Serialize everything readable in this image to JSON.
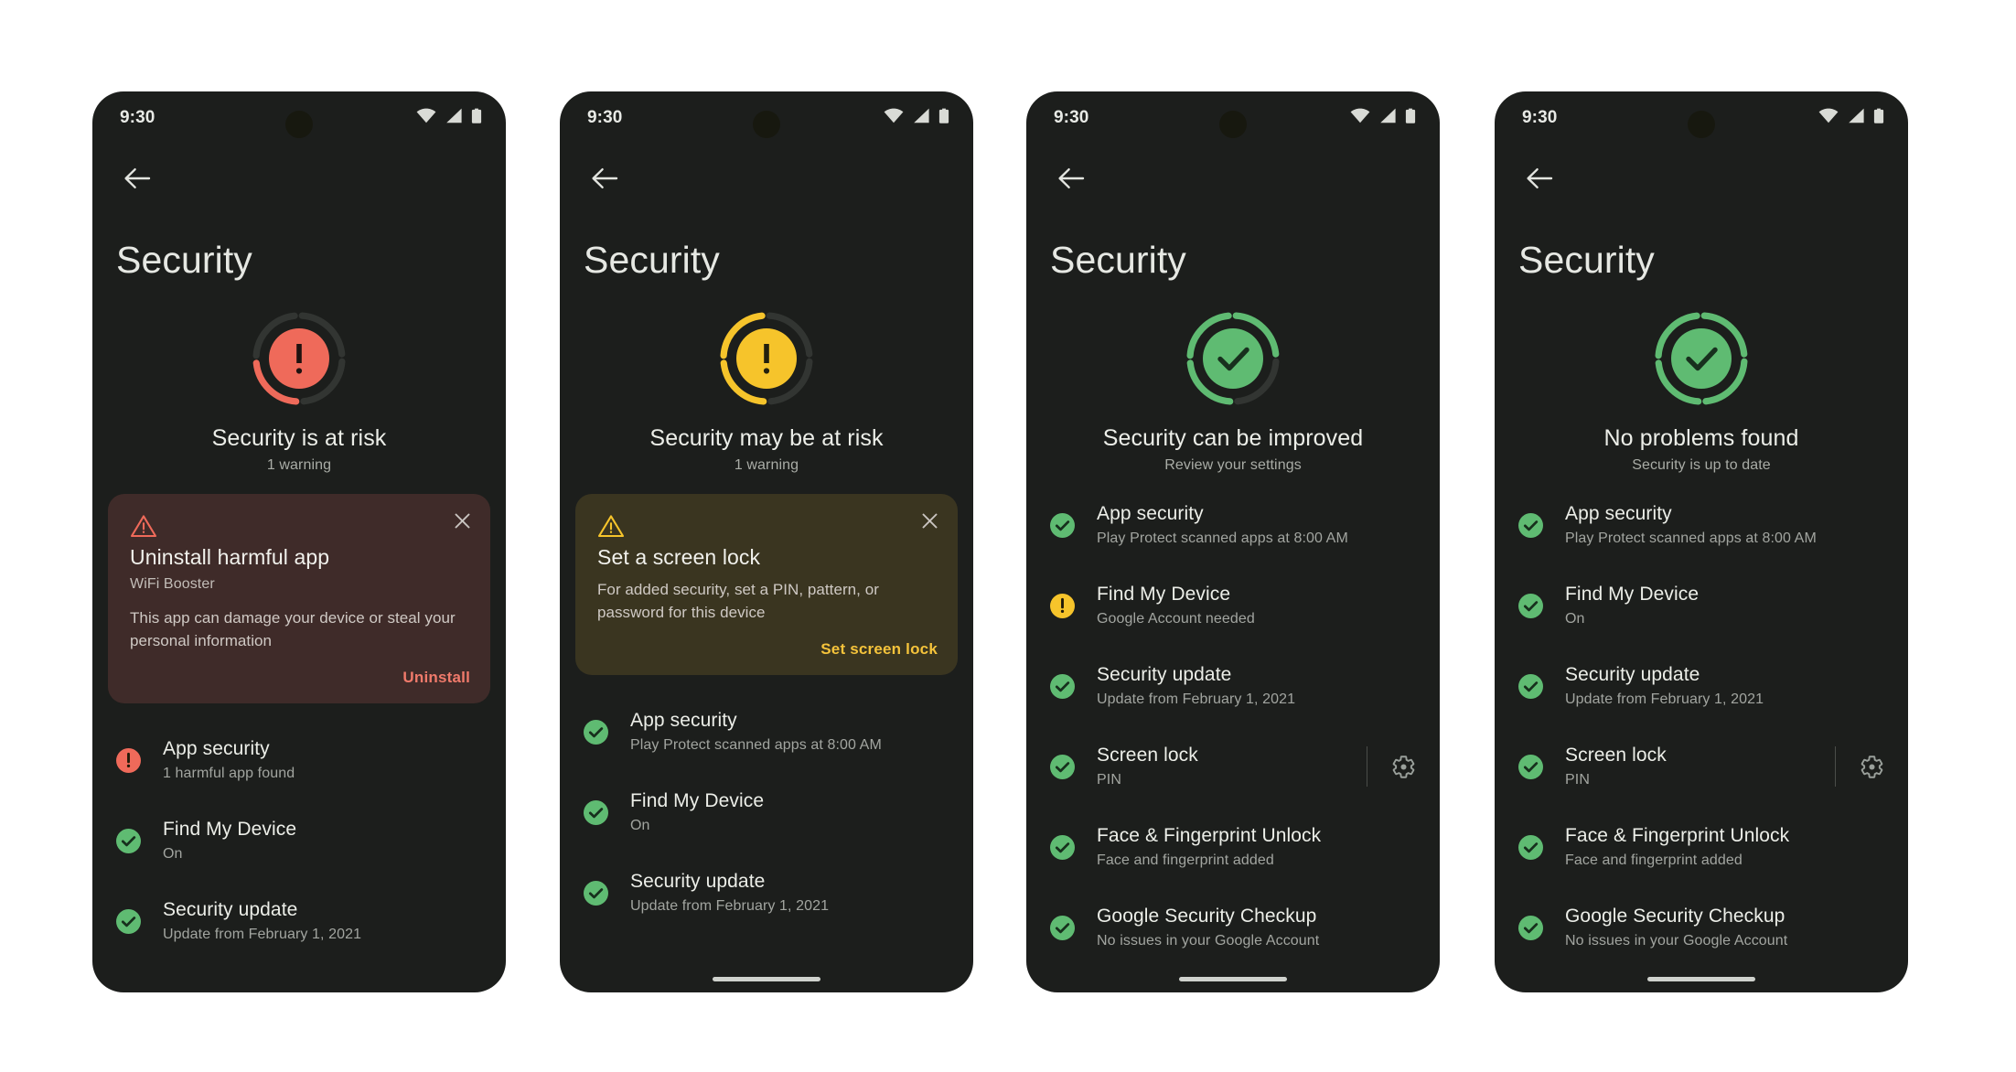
{
  "colors": {
    "page_background": "#ffffff",
    "phone_background": "#1c1e1c",
    "danger": "#ef6a5a",
    "warning": "#f6c42b",
    "success": "#5fbb72",
    "ring_track": "#323532",
    "card_danger_bg": "#3f2b29",
    "card_warn_bg": "#3a3520"
  },
  "statusbar": {
    "time": "9:30",
    "icons": [
      "wifi-icon",
      "cellular-signal-icon",
      "battery-icon"
    ]
  },
  "common": {
    "back_label": "Back",
    "page_title": "Security",
    "close_label": "Close"
  },
  "phones": [
    {
      "id": "phone-at-risk",
      "state": "danger",
      "hero": {
        "title": "Security is at risk",
        "subtitle": "1 warning",
        "icon": "exclamation-icon",
        "ring_segments": [
          "track",
          "track",
          "track",
          "danger"
        ]
      },
      "card": {
        "variant": "danger",
        "icon": "warning-triangle-icon",
        "title": "Uninstall harmful app",
        "app": "WiFi Booster",
        "body": "This app can damage your device or steal your personal information",
        "action": "Uninstall"
      },
      "rows": [
        {
          "status": "danger",
          "icon": "alert-badge-icon",
          "title": "App security",
          "sub": "1 harmful app found"
        },
        {
          "status": "success",
          "icon": "check-badge-icon",
          "title": "Find My Device",
          "sub": "On"
        },
        {
          "status": "success",
          "icon": "check-badge-icon",
          "title": "Security update",
          "sub": "Update from February 1, 2021"
        }
      ],
      "home_indicator": false
    },
    {
      "id": "phone-may-be-at-risk",
      "state": "warning",
      "hero": {
        "title": "Security may be at risk",
        "subtitle": "1 warning",
        "icon": "exclamation-icon",
        "ring_segments": [
          "warning",
          "track",
          "track",
          "warning"
        ]
      },
      "card": {
        "variant": "warning",
        "icon": "warning-triangle-icon",
        "title": "Set a screen lock",
        "app": "",
        "body": "For added security, set a PIN, pattern, or password for this device",
        "action": "Set screen lock"
      },
      "rows": [
        {
          "status": "success",
          "icon": "check-badge-icon",
          "title": "App security",
          "sub": "Play Protect scanned apps at 8:00 AM"
        },
        {
          "status": "success",
          "icon": "check-badge-icon",
          "title": "Find My Device",
          "sub": "On"
        },
        {
          "status": "success",
          "icon": "check-badge-icon",
          "title": "Security update",
          "sub": "Update from February 1, 2021"
        }
      ],
      "home_indicator": true
    },
    {
      "id": "phone-can-be-improved",
      "state": "success",
      "hero": {
        "title": "Security can be improved",
        "subtitle": "Review your settings",
        "icon": "check-icon",
        "ring_segments": [
          "success",
          "success",
          "track",
          "success"
        ]
      },
      "card": null,
      "rows": [
        {
          "status": "success",
          "icon": "check-badge-icon",
          "title": "App security",
          "sub": "Play Protect scanned apps at 8:00 AM"
        },
        {
          "status": "warning",
          "icon": "alert-badge-icon",
          "title": "Find My Device",
          "sub": "Google Account needed"
        },
        {
          "status": "success",
          "icon": "check-badge-icon",
          "title": "Security update",
          "sub": "Update from February 1, 2021"
        },
        {
          "status": "success",
          "icon": "check-badge-icon",
          "title": "Screen lock",
          "sub": "PIN",
          "trailing": "gear-icon"
        },
        {
          "status": "success",
          "icon": "check-badge-icon",
          "title": "Face & Fingerprint Unlock",
          "sub": "Face and fingerprint added"
        },
        {
          "status": "success",
          "icon": "check-badge-icon",
          "title": "Google Security Checkup",
          "sub": "No issues in your Google Account"
        }
      ],
      "home_indicator": true
    },
    {
      "id": "phone-no-problems",
      "state": "success",
      "hero": {
        "title": "No problems found",
        "subtitle": "Security is up to date",
        "icon": "check-icon",
        "ring_segments": [
          "success",
          "success",
          "success",
          "success"
        ]
      },
      "card": null,
      "rows": [
        {
          "status": "success",
          "icon": "check-badge-icon",
          "title": "App security",
          "sub": "Play Protect scanned apps at 8:00 AM"
        },
        {
          "status": "success",
          "icon": "check-badge-icon",
          "title": "Find My Device",
          "sub": "On"
        },
        {
          "status": "success",
          "icon": "check-badge-icon",
          "title": "Security update",
          "sub": "Update from February 1, 2021"
        },
        {
          "status": "success",
          "icon": "check-badge-icon",
          "title": "Screen lock",
          "sub": "PIN",
          "trailing": "gear-icon"
        },
        {
          "status": "success",
          "icon": "check-badge-icon",
          "title": "Face & Fingerprint Unlock",
          "sub": "Face and fingerprint added"
        },
        {
          "status": "success",
          "icon": "check-badge-icon",
          "title": "Google Security Checkup",
          "sub": "No issues in your Google Account"
        }
      ],
      "home_indicator": true
    }
  ]
}
